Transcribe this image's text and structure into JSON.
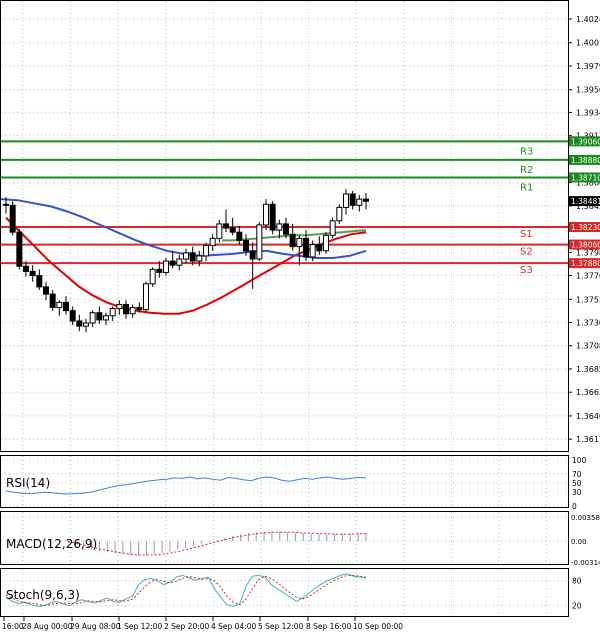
{
  "chart_data": [
    {
      "type": "candlestick",
      "panel": "price",
      "y_ticks": [
        "1.40245",
        "1.40015",
        "1.39790",
        "1.39560",
        "1.39340",
        "1.39115",
        "1.38660",
        "1.38435",
        "1.37985",
        "1.37760",
        "1.37530",
        "1.37305",
        "1.37080",
        "1.36855",
        "1.36630",
        "1.36400",
        "1.36175"
      ],
      "ylim": [
        1.3607,
        1.404
      ],
      "last_price": "1.38481",
      "levels": [
        {
          "name": "R3",
          "value": 1.3906,
          "label": "1.39060",
          "color": "#1a8a1a"
        },
        {
          "name": "R2",
          "value": 1.3888,
          "label": "1.38880",
          "color": "#1a8a1a"
        },
        {
          "name": "R1",
          "value": 1.3871,
          "label": "1.38710",
          "color": "#1a8a1a"
        },
        {
          "name": "S1",
          "value": 1.3823,
          "label": "1.38230",
          "color": "#d42a2a"
        },
        {
          "name": "S2",
          "value": 1.3806,
          "label": "1.38060",
          "color": "#d42a2a"
        },
        {
          "name": "S3",
          "value": 1.3788,
          "label": "1.37880",
          "color": "#d42a2a"
        }
      ],
      "x_ticks": [
        "16:00",
        "28 Aug 00:00",
        "29 Aug 08:00",
        "1 Sep 12:00",
        "2 Sep 20:00",
        "4 Sep 04:00",
        "5 Sep 12:00",
        "8 Sep 16:00",
        "10 Sep 00:00"
      ],
      "candles": [
        [
          1.3845,
          1.3852,
          1.3836,
          1.3844
        ],
        [
          1.3844,
          1.3848,
          1.3815,
          1.3818
        ],
        [
          1.3818,
          1.3821,
          1.3782,
          1.3785
        ],
        [
          1.3785,
          1.379,
          1.3775,
          1.378
        ],
        [
          1.378,
          1.3786,
          1.377,
          1.3776
        ],
        [
          1.3776,
          1.3782,
          1.3762,
          1.3765
        ],
        [
          1.3765,
          1.377,
          1.3752,
          1.3758
        ],
        [
          1.3758,
          1.3762,
          1.3742,
          1.3745
        ],
        [
          1.3745,
          1.3752,
          1.3737,
          1.375
        ],
        [
          1.375,
          1.3756,
          1.3738,
          1.3742
        ],
        [
          1.3742,
          1.3746,
          1.3728,
          1.3732
        ],
        [
          1.3732,
          1.3738,
          1.3722,
          1.3727
        ],
        [
          1.3727,
          1.3734,
          1.3721,
          1.373
        ],
        [
          1.373,
          1.3742,
          1.3726,
          1.374
        ],
        [
          1.374,
          1.3746,
          1.3729,
          1.3733
        ],
        [
          1.3733,
          1.374,
          1.3728,
          1.3737
        ],
        [
          1.3737,
          1.3746,
          1.3732,
          1.3744
        ],
        [
          1.3744,
          1.3752,
          1.3738,
          1.3748
        ],
        [
          1.3748,
          1.3752,
          1.3734,
          1.3739
        ],
        [
          1.3739,
          1.3748,
          1.3735,
          1.3745
        ],
        [
          1.3745,
          1.375,
          1.374,
          1.3743
        ],
        [
          1.3743,
          1.377,
          1.3741,
          1.3768
        ],
        [
          1.3768,
          1.3784,
          1.3765,
          1.3782
        ],
        [
          1.3782,
          1.379,
          1.3774,
          1.3779
        ],
        [
          1.3779,
          1.3793,
          1.3776,
          1.379
        ],
        [
          1.379,
          1.38,
          1.3783,
          1.3786
        ],
        [
          1.3786,
          1.3796,
          1.3781,
          1.3792
        ],
        [
          1.3792,
          1.3802,
          1.3788,
          1.3798
        ],
        [
          1.3798,
          1.3804,
          1.3786,
          1.379
        ],
        [
          1.379,
          1.38,
          1.3785,
          1.3795
        ],
        [
          1.3795,
          1.3808,
          1.379,
          1.3805
        ],
        [
          1.3805,
          1.3816,
          1.38,
          1.3812
        ],
        [
          1.3812,
          1.383,
          1.3808,
          1.3826
        ],
        [
          1.3826,
          1.384,
          1.3818,
          1.3822
        ],
        [
          1.3822,
          1.3832,
          1.3815,
          1.3818
        ],
        [
          1.3818,
          1.3824,
          1.3806,
          1.381
        ],
        [
          1.381,
          1.3816,
          1.3795,
          1.38
        ],
        [
          1.38,
          1.3808,
          1.3763,
          1.3792
        ],
        [
          1.3792,
          1.3828,
          1.379,
          1.3825
        ],
        [
          1.3825,
          1.385,
          1.382,
          1.3845
        ],
        [
          1.3845,
          1.3848,
          1.3816,
          1.382
        ],
        [
          1.382,
          1.383,
          1.3812,
          1.3826
        ],
        [
          1.3826,
          1.3832,
          1.3812,
          1.3816
        ],
        [
          1.3816,
          1.3826,
          1.38,
          1.3804
        ],
        [
          1.3804,
          1.3815,
          1.3786,
          1.3812
        ],
        [
          1.3812,
          1.382,
          1.379,
          1.3794
        ],
        [
          1.3794,
          1.381,
          1.379,
          1.3806
        ],
        [
          1.3806,
          1.3814,
          1.3796,
          1.38
        ],
        [
          1.38,
          1.3818,
          1.3797,
          1.3815
        ],
        [
          1.3815,
          1.3832,
          1.3812,
          1.3829
        ],
        [
          1.3829,
          1.3845,
          1.3826,
          1.3842
        ],
        [
          1.3842,
          1.386,
          1.3835,
          1.3855
        ],
        [
          1.3855,
          1.3858,
          1.384,
          1.3844
        ],
        [
          1.3844,
          1.3854,
          1.3838,
          1.385
        ],
        [
          1.385,
          1.3856,
          1.384,
          1.3848
        ]
      ],
      "series": [
        {
          "name": "red-ma",
          "color": "#e00000",
          "values": [
            1.3832,
            1.3818,
            1.3804,
            1.379,
            1.3778,
            1.3766,
            1.3757,
            1.375,
            1.3745,
            1.3742,
            1.374,
            1.3739,
            1.3739,
            1.3742,
            1.3748,
            1.3755,
            1.3763,
            1.3771,
            1.3779,
            1.3787,
            1.3795,
            1.3801,
            1.3807,
            1.3812,
            1.3816,
            1.3818
          ]
        },
        {
          "name": "blue-ma",
          "color": "#3355cc",
          "values": [
            1.385,
            1.3849,
            1.3846,
            1.3843,
            1.3838,
            1.3832,
            1.3825,
            1.3818,
            1.3811,
            1.3805,
            1.38,
            1.3797,
            1.3795,
            1.3796,
            1.3797,
            1.3799,
            1.38,
            1.3797,
            1.3795,
            1.3793,
            1.3793,
            1.3795,
            1.38
          ]
        },
        {
          "name": "green-ma",
          "color": "#5a9a50",
          "values": [
            1.381,
            1.381,
            1.3811,
            1.3812,
            1.3813,
            1.3814,
            1.3815,
            1.3815,
            1.3816,
            1.3817,
            1.3818,
            1.3819,
            1.382
          ]
        }
      ]
    },
    {
      "type": "line",
      "panel": "rsi",
      "label": "RSI(14)",
      "y_ticks": [
        "100",
        "70",
        "50",
        "30",
        "0"
      ],
      "ylim": [
        0,
        100
      ],
      "values": [
        33,
        30,
        28,
        27,
        28,
        30,
        29,
        27,
        26,
        27,
        28,
        30,
        34,
        38,
        42,
        45,
        47,
        50,
        53,
        55,
        57,
        58,
        61,
        60,
        63,
        59,
        61,
        58,
        56,
        62,
        60,
        57,
        55,
        60,
        63,
        61,
        56,
        54,
        57,
        60,
        58,
        61,
        63,
        60,
        58,
        60,
        62,
        61
      ]
    },
    {
      "type": "histogram",
      "panel": "macd",
      "label": "MACD(12,26,9)",
      "y_ticks": [
        "0.003587",
        "0.00",
        "-0.00314"
      ],
      "ylim": [
        -0.00314,
        0.003587
      ],
      "values": [
        -0.0003,
        -0.0006,
        -0.0009,
        -0.0012,
        -0.0015,
        -0.0017,
        -0.0019,
        -0.002,
        -0.0021,
        -0.0022,
        -0.0021,
        -0.002,
        -0.0018,
        -0.0016,
        -0.0013,
        -0.001,
        -0.0007,
        -0.0004,
        -0.0001,
        0.0002,
        0.0005,
        0.0008,
        0.001,
        0.0012,
        0.0013,
        0.0014,
        0.0014,
        0.0014,
        0.0013,
        0.0012,
        0.0012,
        0.0011,
        0.0011,
        0.001,
        0.001,
        0.001,
        0.0011,
        0.0011,
        0.0012
      ],
      "signal": [
        -0.0001,
        -0.0003,
        -0.0006,
        -0.0009,
        -0.0012,
        -0.0014,
        -0.0016,
        -0.0018,
        -0.002,
        -0.0021,
        -0.0021,
        -0.0021,
        -0.002,
        -0.0018,
        -0.0016,
        -0.0013,
        -0.001,
        -0.0007,
        -0.0004,
        -0.0001,
        0.0002,
        0.0005,
        0.0007,
        0.0009,
        0.0011,
        0.0012,
        0.0013,
        0.0013,
        0.0013,
        0.0013,
        0.0012,
        0.0012,
        0.0011,
        0.0011,
        0.001,
        0.001,
        0.001,
        0.0011,
        0.0011
      ]
    },
    {
      "type": "line",
      "panel": "stoch",
      "label": "Stoch(9,6,3)",
      "y_ticks": [
        "80",
        "20"
      ],
      "ylim": [
        0,
        100
      ],
      "values": [
        40,
        30,
        25,
        28,
        22,
        18,
        20,
        26,
        30,
        24,
        20,
        28,
        34,
        30,
        26,
        32,
        38,
        30,
        28,
        36,
        42,
        70,
        82,
        85,
        78,
        70,
        76,
        88,
        92,
        86,
        80,
        84,
        88,
        60,
        40,
        22,
        18,
        24,
        66,
        90,
        92,
        88,
        70,
        60,
        50,
        40,
        30,
        38,
        50,
        62,
        72,
        80,
        86,
        92,
        96,
        90,
        88,
        85
      ],
      "signal": [
        45,
        38,
        30,
        27,
        26,
        23,
        20,
        22,
        25,
        27,
        25,
        24,
        27,
        31,
        30,
        29,
        32,
        34,
        32,
        31,
        35,
        50,
        65,
        78,
        82,
        78,
        74,
        78,
        85,
        89,
        86,
        83,
        84,
        80,
        64,
        42,
        28,
        22,
        36,
        60,
        82,
        90,
        84,
        74,
        62,
        50,
        40,
        36,
        42,
        52,
        63,
        72,
        80,
        87,
        92,
        92,
        90,
        88
      ]
    }
  ]
}
